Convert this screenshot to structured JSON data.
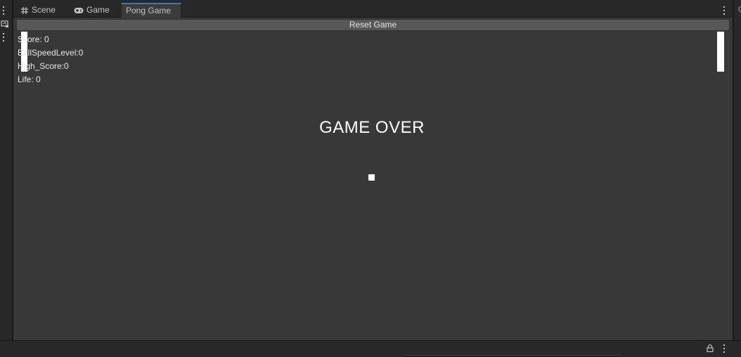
{
  "tabs": [
    {
      "label": "Scene",
      "icon": "grid-icon"
    },
    {
      "label": "Game",
      "icon": "gamepad-icon"
    },
    {
      "label": "Pong Game",
      "icon": ""
    }
  ],
  "game": {
    "reset_label": "Reset Game",
    "hud": {
      "score": "Score: 0",
      "ball_speed": "BallSpeedLevel:0",
      "high_score": "High_Score:0",
      "life": "Life: 0"
    },
    "status": "GAME OVER"
  },
  "colors": {
    "background": "#383838",
    "chrome": "#282828",
    "active_tab_accent": "#3a79bb",
    "button": "#585858",
    "game_objects": "#ffffff"
  }
}
